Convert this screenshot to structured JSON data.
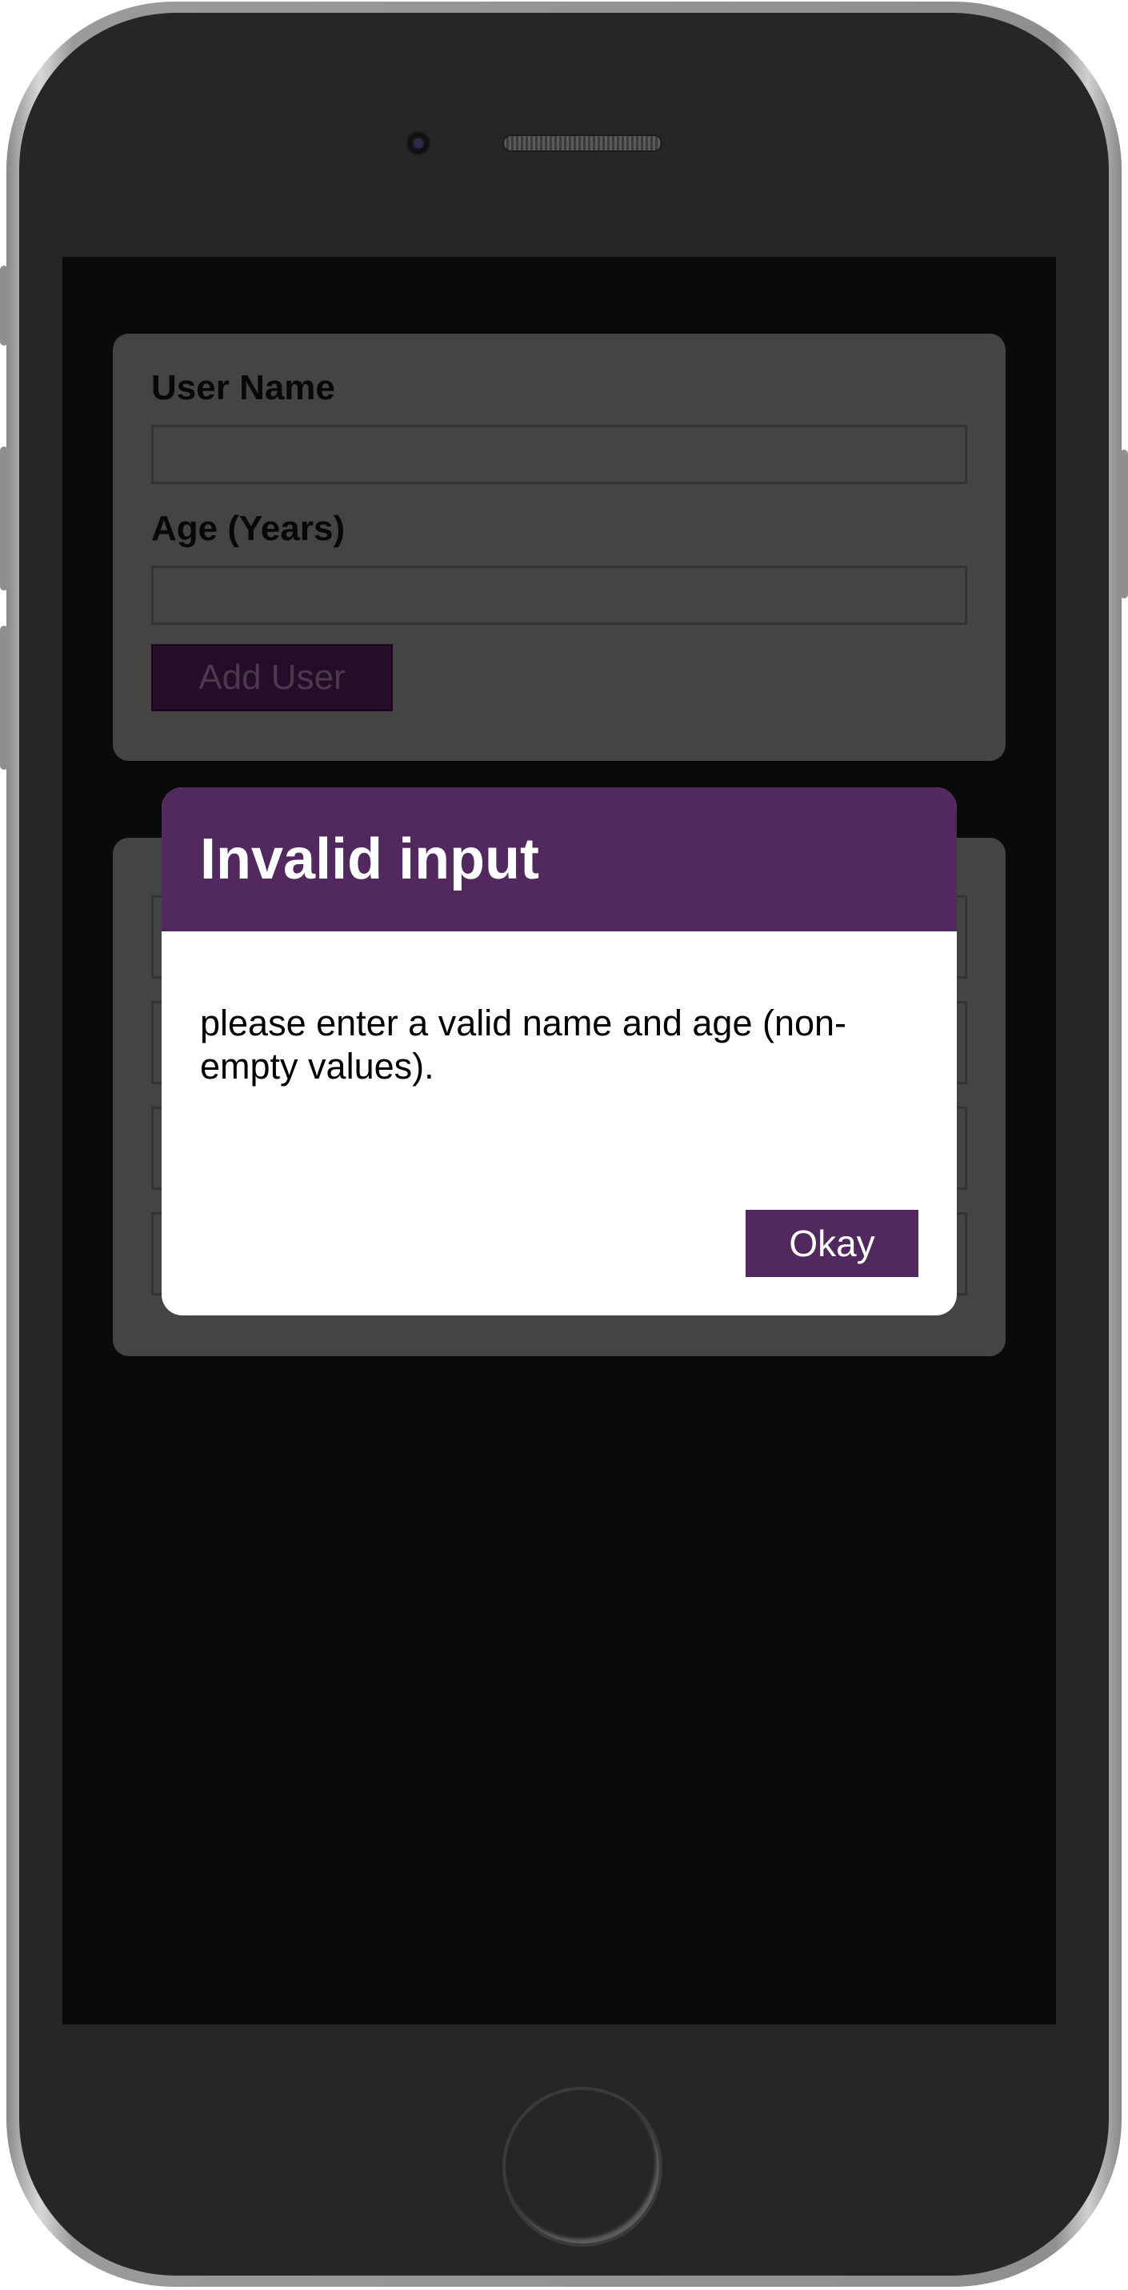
{
  "form": {
    "username_label": "User Name",
    "username_value": "",
    "age_label": "Age (Years)",
    "age_value": "",
    "add_button_label": "Add User"
  },
  "modal": {
    "title": "Invalid input",
    "message": "please enter a valid name and age (non-empty values).",
    "okay_button_label": "Okay"
  },
  "colors": {
    "accent": "#52295e",
    "backdrop": "#0a0a0a",
    "card": "#444444"
  }
}
